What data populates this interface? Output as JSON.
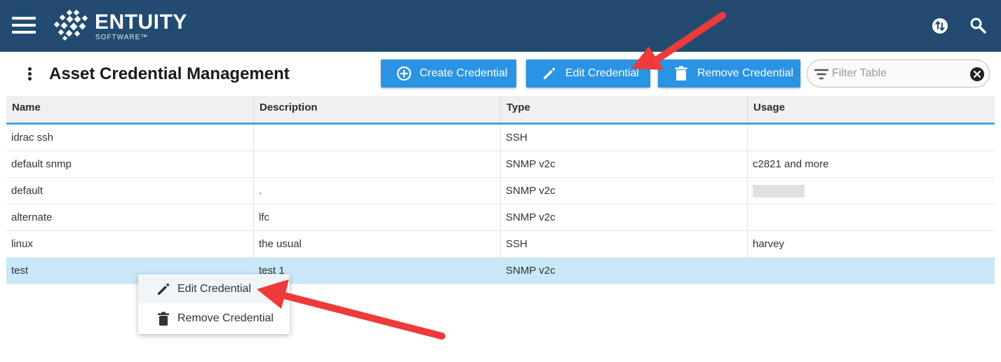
{
  "app": {
    "brand_name": "ENTUITY",
    "brand_sub": "SOFTWARE™"
  },
  "header": {
    "title": "Asset Credential Management",
    "buttons": {
      "create": "Create Credential",
      "edit": "Edit Credential",
      "remove": "Remove Credential"
    },
    "filter": {
      "placeholder": "Filter Table",
      "value": ""
    }
  },
  "table": {
    "columns": [
      "Name",
      "Description",
      "Type",
      "Usage"
    ],
    "rows": [
      {
        "name": "idrac ssh",
        "description": "",
        "type": "SSH",
        "usage": ""
      },
      {
        "name": "default snmp",
        "description": "",
        "type": "SNMP v2c",
        "usage": "c2821 and more"
      },
      {
        "name": "default",
        "description": ".",
        "type": "SNMP v2c",
        "usage": ""
      },
      {
        "name": "alternate",
        "description": "lfc",
        "type": "SNMP v2c",
        "usage": ""
      },
      {
        "name": "linux",
        "description": "the usual",
        "type": "SSH",
        "usage": "harvey"
      },
      {
        "name": "test",
        "description": "test 1",
        "type": "SNMP v2c",
        "usage": ""
      }
    ],
    "selected_row": "test"
  },
  "context_menu": {
    "items": [
      "Edit Credential",
      "Remove Credential"
    ]
  },
  "colors": {
    "topbar": "#234b72",
    "accent": "#2a93e4",
    "selected_row": "#c8e8f8",
    "annotation_arrow": "#ee3a3a"
  },
  "icons": {
    "menu": "hamburger-menu-icon",
    "sync": "sync-icon",
    "search": "search-icon",
    "create": "plus-circle-icon",
    "edit": "pencil-icon",
    "remove": "trash-icon",
    "filter": "filter-icon",
    "clear": "clear-icon"
  }
}
